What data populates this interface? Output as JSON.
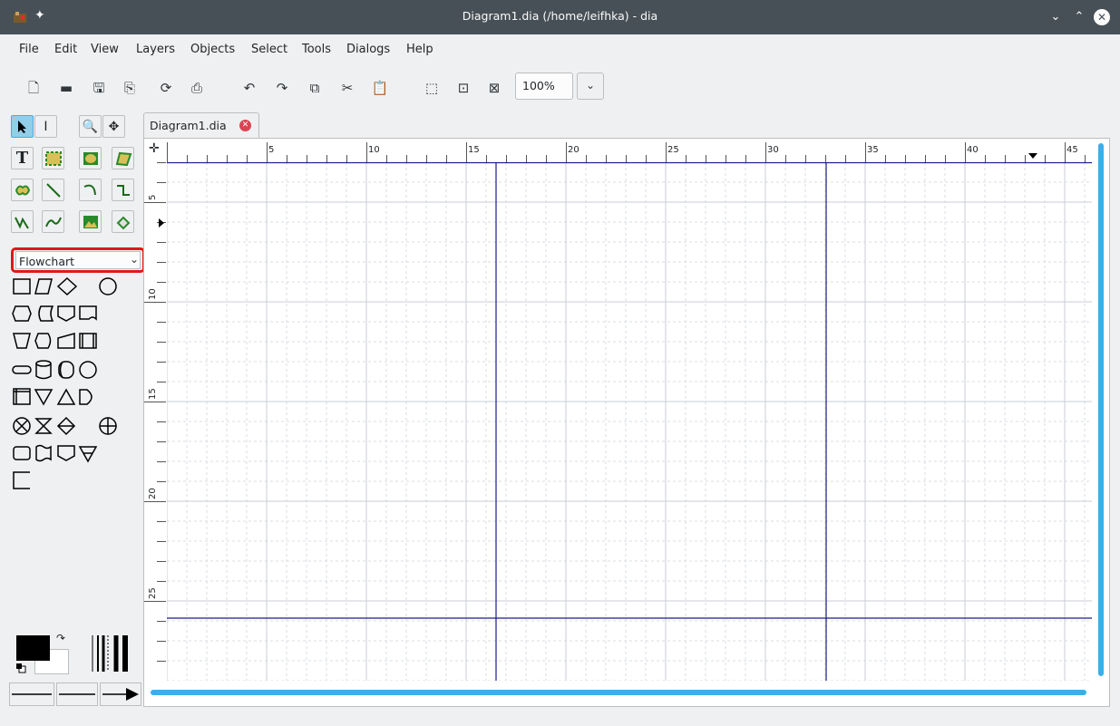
{
  "window": {
    "title": "Diagram1.dia (/home/leifhka) - dia"
  },
  "menu": [
    "File",
    "Edit",
    "View",
    "Layers",
    "Objects",
    "Select",
    "Tools",
    "Dialogs",
    "Help"
  ],
  "toolbar": {
    "zoom_value": "100%"
  },
  "tabs": [
    {
      "label": "Diagram1.dia",
      "closable": true
    }
  ],
  "sheet_selector": {
    "value": "Flowchart"
  },
  "ruler": {
    "horizontal_labels": [
      "5",
      "10",
      "15",
      "20",
      "25",
      "30",
      "35",
      "40",
      "45"
    ],
    "vertical_labels": [
      "5",
      "10",
      "15",
      "20",
      "25"
    ]
  },
  "colors": {
    "accent": "#3daee9",
    "highlight": "#e11818",
    "guide": "#1a1a8c",
    "foreground": "#000000",
    "background": "#ffffff"
  },
  "icons": [
    "app-icon",
    "pin-icon",
    "minimize-icon",
    "maximize-icon",
    "close-icon",
    "new-icon",
    "open-icon",
    "save-icon",
    "save-as-icon",
    "reload-icon",
    "print-icon",
    "undo-icon",
    "redo-icon",
    "copy-icon",
    "cut-icon",
    "paste-icon",
    "zoom-fit-icon",
    "zoom-best-icon",
    "zoom-selection-icon",
    "snap-grid-icon",
    "object-snap-icon"
  ]
}
